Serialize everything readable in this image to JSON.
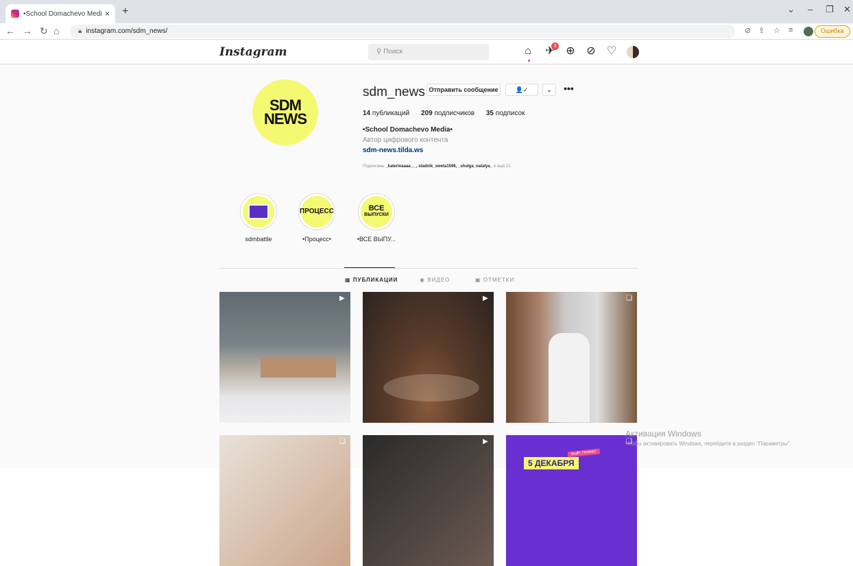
{
  "browser": {
    "tab_title": "•School Domachevo Media• (@s",
    "tab_close": "×",
    "new_tab": "+",
    "url": "instagram.com/sdm_news/",
    "error_label": "Ошибка",
    "win_min": "–",
    "win_restore": "❐",
    "win_close": "✕",
    "tab_dropdown": "⌄"
  },
  "ig": {
    "logo": "Instagram",
    "search_placeholder": "Поиск",
    "notif_count": "3"
  },
  "profile": {
    "avatar_line1": "SDM",
    "avatar_line2": "NEWS",
    "username": "sdm_news",
    "message_button": "Отправить сообщение",
    "follow_button": "👤✓",
    "dropdown_button": "⌄",
    "more": "•••",
    "posts_count": "14",
    "posts_label": "публикаций",
    "followers_count": "209",
    "followers_label": "подписчиков",
    "following_count": "35",
    "following_label": "подписок",
    "full_name": "•School Domachevo Media•",
    "category": "Автор цифрового контента",
    "website": "sdm-news.tilda.ws",
    "followed_by_prefix": "Подписаны",
    "followed_by_users": "_katerinaaaa_._, stadnik_sweta1596, _shulga_natalya_",
    "followed_by_suffix": "и ещё 21"
  },
  "highlights": [
    {
      "label": "sdmbattle"
    },
    {
      "label": "•Процесс•",
      "cover_text": "ПРОЦЕСС"
    },
    {
      "label": "•ВСЕ ВЫПУ...",
      "cover_line1": "ВСЕ",
      "cover_line2": "ВЫПУСКИ"
    }
  ],
  "tabs": {
    "posts": "ПУБЛИКАЦИИ",
    "video": "ВИДЕО",
    "tagged": "ОТМЕТКИ"
  },
  "posts": [
    {
      "kind": "video"
    },
    {
      "kind": "video"
    },
    {
      "kind": "carousel"
    },
    {
      "kind": "carousel"
    },
    {
      "kind": "video"
    },
    {
      "kind": "carousel",
      "text": "5 ДЕКАБРЯ",
      "tag": "ВЫЙТ ГРОМКО"
    }
  ],
  "watermark": {
    "title": "Активация Windows",
    "subtitle": "Чтобы активировать Windows, перейдите в раздел \"Параметры\"."
  }
}
